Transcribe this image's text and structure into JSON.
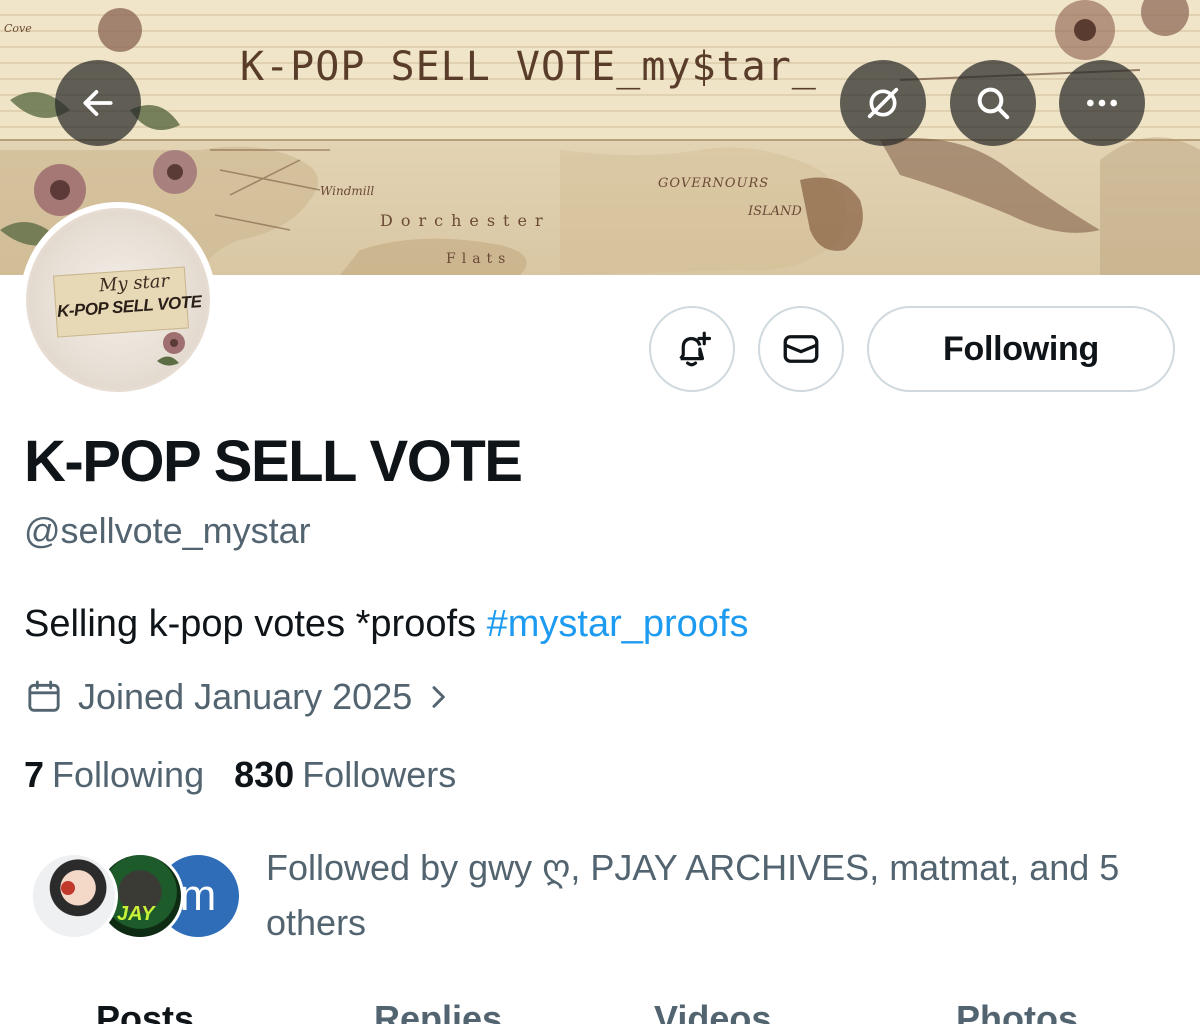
{
  "banner": {
    "title": "K-POP SELL VOTE_my$tar_",
    "map_labels": {
      "dorchester": "Dorchester",
      "flats": "Flats",
      "governours": "GOVERNOURS",
      "island": "ISLAND",
      "windmill": "Windmill",
      "cove": "Cove"
    }
  },
  "header": {
    "back_icon": "arrow-left-icon",
    "grok_icon": "grok-icon",
    "search_icon": "search-icon",
    "more_icon": "more-horizontal-icon"
  },
  "avatar": {
    "script": "My star",
    "brand": "K-POP SELL VOTE"
  },
  "actions": {
    "notify_icon": "bell-plus-icon",
    "message_icon": "envelope-icon",
    "following_label": "Following"
  },
  "profile": {
    "display_name": "K-POP SELL VOTE",
    "handle": "@sellvote_mystar",
    "bio_text": "Selling k-pop votes *proofs ",
    "bio_hashtag": "#mystar_proofs",
    "joined": "Joined January 2025",
    "following_count": "7",
    "following_label": "Following",
    "followers_count": "830",
    "followers_label": "Followers"
  },
  "followed_by": {
    "text": "Followed by gwy ღ, PJAY ARCHIVES, matmat, and 5 others",
    "avatar_3_letter": "m",
    "avatar_2_text": "JAY"
  },
  "tabs": [
    "Posts",
    "Replies",
    "Videos",
    "Photos"
  ],
  "colors": {
    "accent": "#1d9bf0",
    "secondary_text": "#536471",
    "primary_text": "#0f1419",
    "border": "#cfd9de"
  }
}
